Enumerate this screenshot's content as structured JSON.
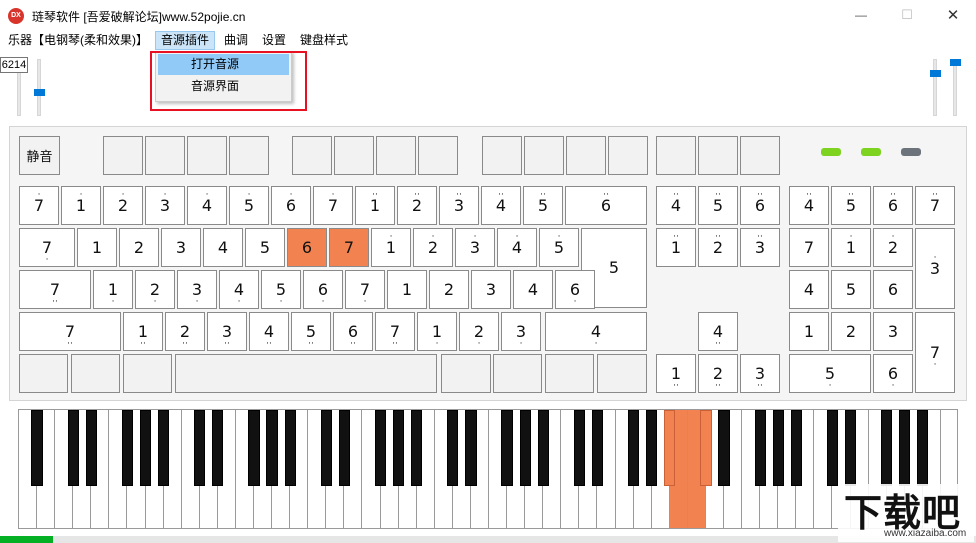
{
  "window": {
    "title": "琏琴软件 [吾爱破解论坛]www.52pojie.cn",
    "icon_text": "DX",
    "controls": [
      "—",
      "☐",
      "✕"
    ]
  },
  "menu": {
    "items": [
      {
        "label": "乐器【电钢琴(柔和效果)】"
      },
      {
        "label": "音源插件"
      },
      {
        "label": "曲调"
      },
      {
        "label": "设置"
      },
      {
        "label": "键盘样式"
      }
    ],
    "dropdown": [
      "打开音源",
      "音源界面"
    ]
  },
  "tooltip": "6214",
  "sliders": {
    "left": [
      0.9,
      0.47
    ],
    "right": [
      0.82,
      1.0
    ]
  },
  "mute_label": "静音",
  "leds": [
    "#7ed321",
    "#7ed321",
    "#6d737a"
  ],
  "keyboard": {
    "row1": [
      [
        "7",
        "u"
      ],
      [
        "1",
        "u"
      ],
      [
        "2",
        "u"
      ],
      [
        "3",
        "u"
      ],
      [
        "4",
        "u"
      ],
      [
        "5",
        "u"
      ],
      [
        "6",
        "u"
      ],
      [
        "7",
        "u"
      ],
      [
        "1",
        "uu"
      ],
      [
        "2",
        "uu"
      ],
      [
        "3",
        "uu"
      ],
      [
        "4",
        "uu"
      ],
      [
        "5",
        "uu"
      ],
      [
        "6",
        "uu"
      ]
    ],
    "row2": [
      [
        "7",
        "d"
      ],
      [
        "1",
        ""
      ],
      [
        "2",
        ""
      ],
      [
        "3",
        ""
      ],
      [
        "4",
        ""
      ],
      [
        "5",
        ""
      ],
      [
        "6",
        ""
      ],
      [
        "7",
        ""
      ],
      [
        "1",
        "u"
      ],
      [
        "2",
        "u"
      ],
      [
        "3",
        "u"
      ],
      [
        "4",
        "u"
      ],
      [
        "5",
        "u"
      ],
      [
        "5",
        ""
      ]
    ],
    "row3": [
      [
        "7",
        "dd"
      ],
      [
        "1",
        "d"
      ],
      [
        "2",
        "d"
      ],
      [
        "3",
        "d"
      ],
      [
        "4",
        "d"
      ],
      [
        "5",
        "d"
      ],
      [
        "6",
        "d"
      ],
      [
        "7",
        "d"
      ],
      [
        "1",
        ""
      ],
      [
        "2",
        ""
      ],
      [
        "3",
        ""
      ],
      [
        "4",
        ""
      ],
      [
        "6",
        "d"
      ]
    ],
    "row4": [
      [
        "7",
        "ddd"
      ],
      [
        "1",
        "dd"
      ],
      [
        "2",
        "dd"
      ],
      [
        "3",
        "dd"
      ],
      [
        "4",
        "dd"
      ],
      [
        "5",
        "dd"
      ],
      [
        "6",
        "dd"
      ],
      [
        "7",
        "dd"
      ],
      [
        "1",
        "d"
      ],
      [
        "2",
        "d"
      ],
      [
        "3",
        "d"
      ],
      [
        "4",
        "d"
      ]
    ],
    "nav": [
      [
        "4",
        "uu"
      ],
      [
        "5",
        "uu"
      ],
      [
        "6",
        "uu"
      ],
      [
        "1",
        "uuu"
      ],
      [
        "2",
        "uuu"
      ],
      [
        "3",
        "uuu"
      ],
      [
        "4",
        "dd"
      ],
      [
        "1",
        "ddd"
      ],
      [
        "2",
        "ddd"
      ],
      [
        "3",
        "ddd"
      ]
    ],
    "numpad": [
      [
        "4",
        "uu"
      ],
      [
        "5",
        "uu"
      ],
      [
        "6",
        "uu"
      ],
      [
        "7",
        "uu"
      ],
      [
        "7",
        ""
      ],
      [
        "1",
        "u"
      ],
      [
        "2",
        "u"
      ],
      [
        "3",
        "u"
      ],
      [
        "4",
        ""
      ],
      [
        "5",
        ""
      ],
      [
        "6",
        ""
      ],
      [
        "1",
        ""
      ],
      [
        "2",
        ""
      ],
      [
        "3",
        ""
      ],
      [
        "7",
        "d"
      ],
      [
        "5",
        "d"
      ],
      [
        "6",
        "d"
      ]
    ]
  },
  "active_keys": [
    "row2.6",
    "row2.7"
  ],
  "piano_active_whites": [
    36,
    37
  ],
  "piano_active_blacks": [
    25,
    26
  ],
  "progress": 0.054,
  "watermark": {
    "big": "下载吧",
    "small": "www.xiazaiba.com"
  }
}
